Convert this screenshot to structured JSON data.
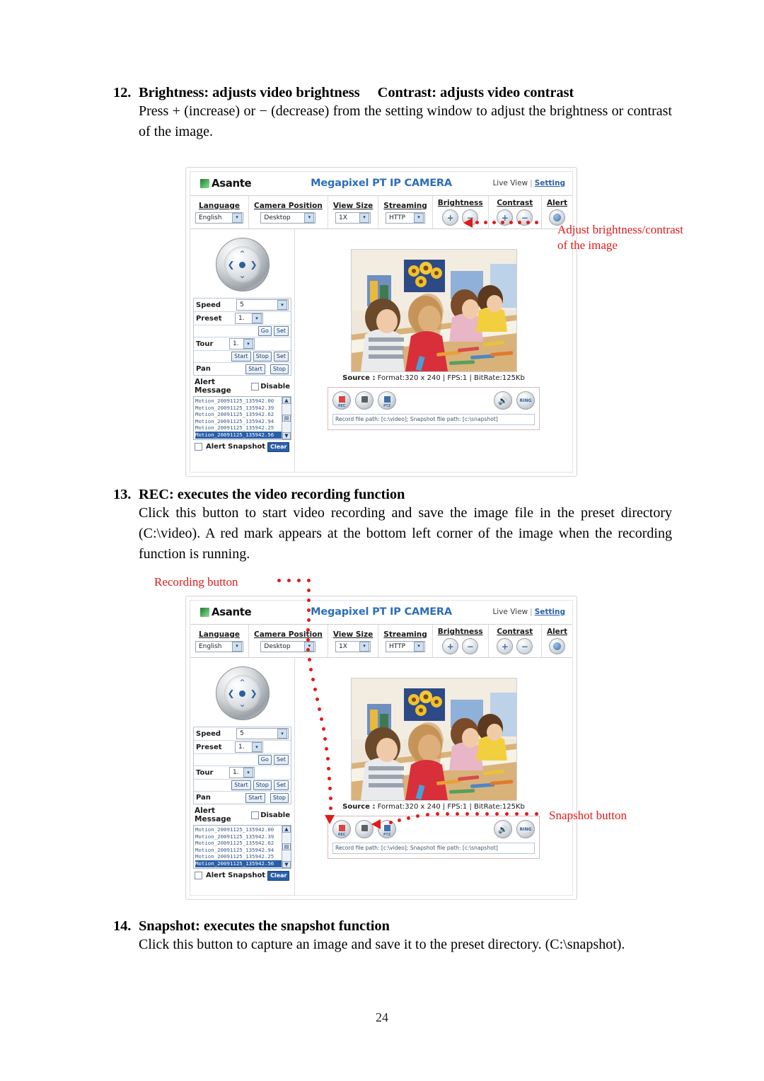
{
  "page_number": "24",
  "sections": [
    {
      "number": "12.",
      "heading": "Brightness: adjusts video brightness     Contrast: adjusts video contrast",
      "body": "Press + (increase) or −  (decrease) from the setting window to adjust the brightness or contrast of the image."
    },
    {
      "number": "13.",
      "heading": "REC: executes the video recording function",
      "body": "Click this button to start video recording and save the image file in the preset directory (C:\\video). A red mark appears at the bottom left corner of the image when the recording function is running."
    },
    {
      "number": "14.",
      "heading": "Snapshot: executes the snapshot function",
      "body": "Click this button to capture an image and save it to the preset directory. (C:\\snapshot)."
    }
  ],
  "annotations": {
    "brightness_contrast": "Adjust brightness/contrast\nof the image",
    "recording_button": "Recording button",
    "snapshot_button": "Snapshot button"
  },
  "camera_ui": {
    "brand": "Asante",
    "title": "Megapixel PT IP CAMERA",
    "live_view": "Live View",
    "separator": "|",
    "setting": "Setting",
    "toolbar": [
      {
        "label": "Language",
        "type": "select",
        "value": "English"
      },
      {
        "label": "Camera Position",
        "type": "select",
        "value": "Desktop"
      },
      {
        "label": "View Size",
        "type": "select",
        "value": "1X"
      },
      {
        "label": "Streaming",
        "type": "select",
        "value": "HTTP"
      },
      {
        "label": "Brightness",
        "type": "plusminus",
        "plus": "+",
        "minus": "−"
      },
      {
        "label": "Contrast",
        "type": "plusminus",
        "plus": "+",
        "minus": "−"
      },
      {
        "label": "Alert",
        "type": "icon",
        "icon": "globe-icon"
      }
    ],
    "controls": {
      "speed_label": "Speed",
      "speed_value": "5",
      "preset_label": "Preset",
      "preset_value": "1.",
      "go_button": "Go",
      "set_button": "Set",
      "tour_label": "Tour",
      "tour_value": "1.",
      "tour_start": "Start",
      "tour_stop": "Stop",
      "tour_set": "Set",
      "pan_label": "Pan",
      "pan_start": "Start",
      "pan_stop": "Stop",
      "alert_message_label": "Alert Message",
      "disable_label": "Disable",
      "alert_snapshot_label": "Alert Snapshot",
      "clear_button": "Clear"
    },
    "alert_log": [
      {
        "text": "Motion_20091125_135942.00",
        "selected": false
      },
      {
        "text": "Motion_20091125_135942.39",
        "selected": false
      },
      {
        "text": "Motion_20091125_135942.62",
        "selected": false
      },
      {
        "text": "Motion_20091125_135942.94",
        "selected": false
      },
      {
        "text": "Motion_20091125_135942.25",
        "selected": false
      },
      {
        "text": "Motion_20091125_135942.56",
        "selected": true
      }
    ],
    "source_line": "Source : Format:320 x 240 | FPS:1 | BitRate:125Kb",
    "source_prefix": "Source :",
    "source_rest": " Format:320 x 240 | FPS:1 | BitRate:125Kb",
    "media_buttons": {
      "rec": "REC",
      "snapshot": "snapshot-icon",
      "ptz": "PTZ",
      "speaker": "speaker-icon",
      "ring": "RING"
    },
    "path_bar": "Record file path: [c:\\video]; Snapshot file path: [c:\\snapshot]"
  },
  "colors": {
    "annotation_red": "#e01b1b",
    "ui_title_blue": "#2d6fb8",
    "link_blue": "#2a5fa8",
    "selection_blue": "#2a5fa8"
  }
}
